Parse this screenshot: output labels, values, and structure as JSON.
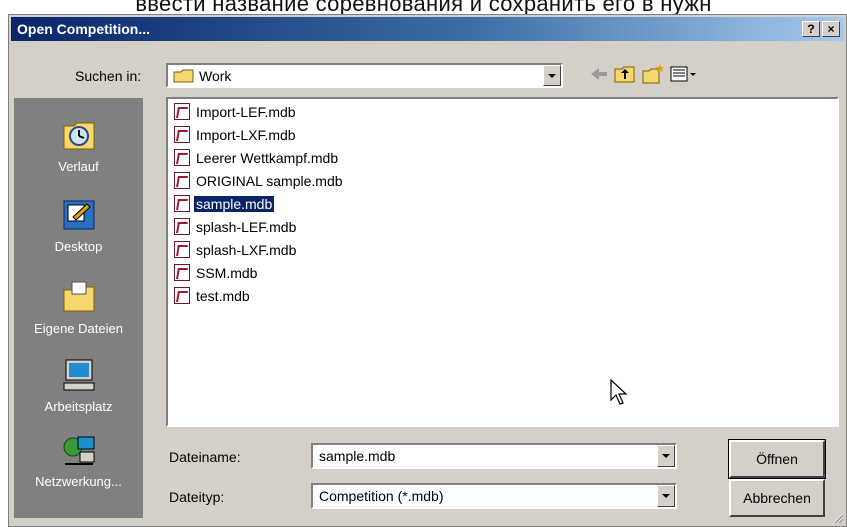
{
  "caption": "ввести название соревнования и сохранить его в нужн",
  "dialog": {
    "title": "Open Competition...",
    "help_glyph": "?",
    "close_glyph": "×"
  },
  "look_in": {
    "label": "Suchen in:",
    "value": "Work"
  },
  "toolbar": [
    {
      "name": "back-arrow-icon"
    },
    {
      "name": "up-folder-icon"
    },
    {
      "name": "new-folder-icon"
    },
    {
      "name": "view-menu-icon"
    }
  ],
  "places": [
    {
      "label": "Verlauf",
      "icon": "history-icon"
    },
    {
      "label": "Desktop",
      "icon": "desktop-icon"
    },
    {
      "label": "Eigene Dateien",
      "icon": "my-documents-icon"
    },
    {
      "label": "Arbeitsplatz",
      "icon": "my-computer-icon"
    },
    {
      "label": "Netzwerkung...",
      "icon": "network-icon"
    }
  ],
  "files": [
    {
      "name": "Import-LEF.mdb",
      "selected": false
    },
    {
      "name": "Import-LXF.mdb",
      "selected": false
    },
    {
      "name": "Leerer Wettkampf.mdb",
      "selected": false
    },
    {
      "name": "ORIGINAL sample.mdb",
      "selected": false
    },
    {
      "name": "sample.mdb",
      "selected": true
    },
    {
      "name": "splash-LEF.mdb",
      "selected": false
    },
    {
      "name": "splash-LXF.mdb",
      "selected": false
    },
    {
      "name": "SSM.mdb",
      "selected": false
    },
    {
      "name": "test.mdb",
      "selected": false
    }
  ],
  "filename": {
    "label": "Dateiname:",
    "value": "sample.mdb"
  },
  "filetype": {
    "label": "Dateityp:",
    "value": "Competition (*.mdb)"
  },
  "buttons": {
    "open": "Öffnen",
    "cancel": "Abbrechen"
  },
  "colors": {
    "title_bar": "#0a246a",
    "selection": "#0a246a",
    "places_bg": "#808080",
    "face": "#d4d0c8"
  }
}
